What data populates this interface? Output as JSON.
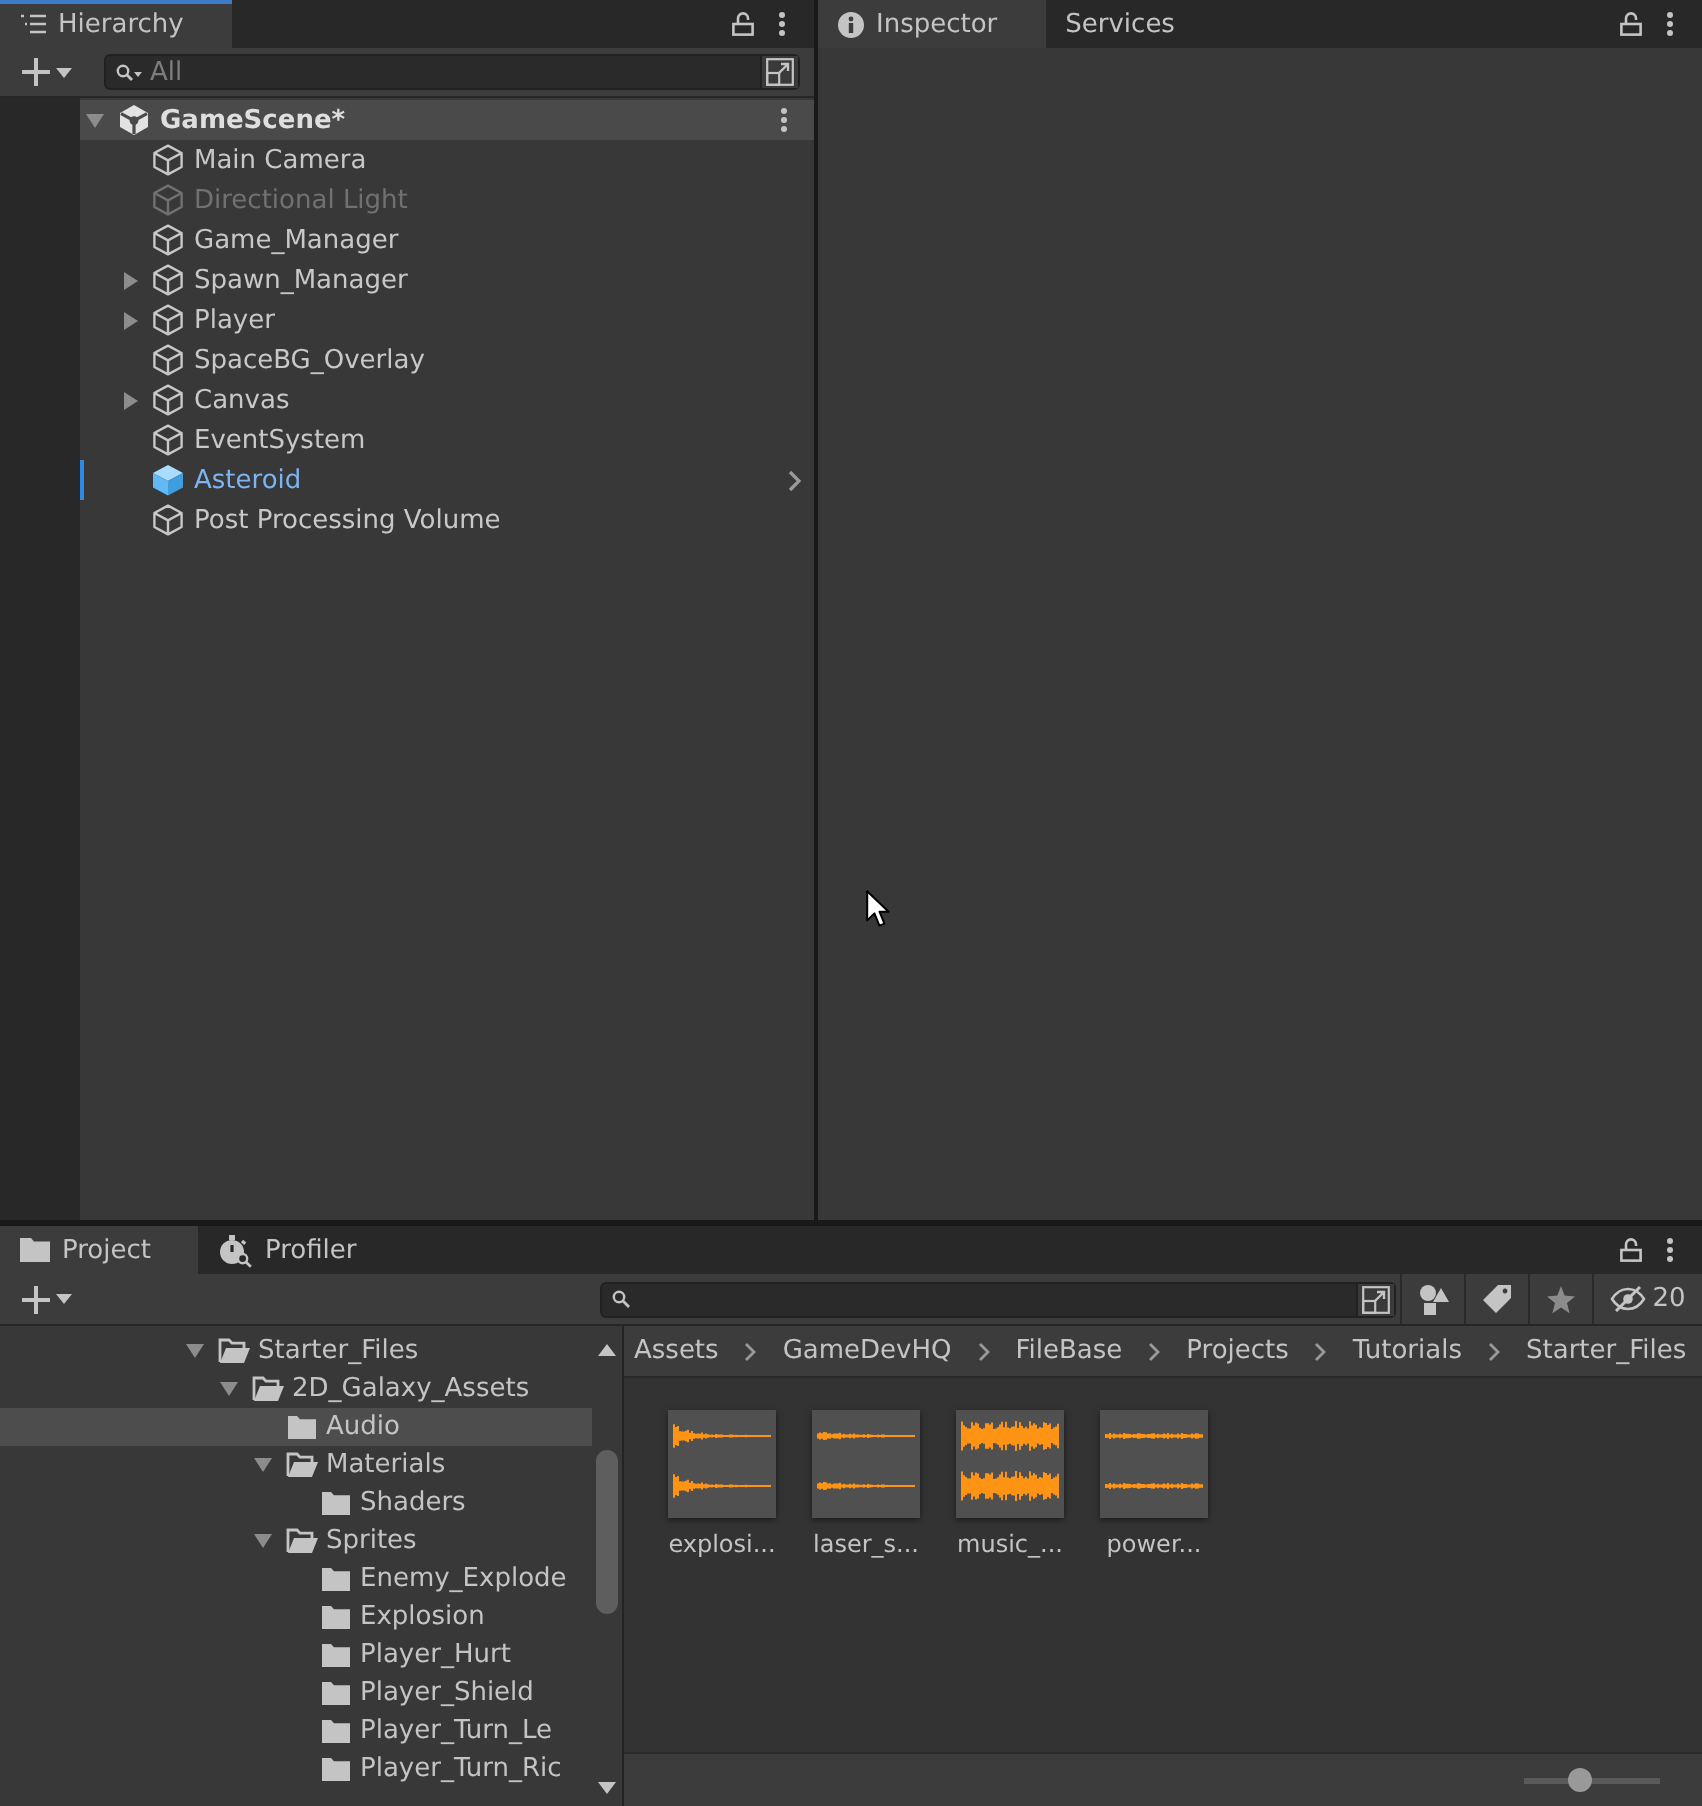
{
  "hierarchy": {
    "focused": true,
    "tabs": [
      {
        "label": "Hierarchy",
        "selected": true
      }
    ],
    "search": {
      "placeholder": "All"
    },
    "scene": {
      "name": "GameScene*",
      "expanded": true,
      "objects": [
        {
          "name": "Main Camera",
          "kind": "object",
          "active": true,
          "expandable": false,
          "overridden": false,
          "selected": false
        },
        {
          "name": "Directional Light",
          "kind": "object",
          "active": false,
          "expandable": false,
          "overridden": false,
          "selected": false
        },
        {
          "name": "Game_Manager",
          "kind": "object",
          "active": true,
          "expandable": false,
          "overridden": false,
          "selected": false
        },
        {
          "name": "Spawn_Manager",
          "kind": "object",
          "active": true,
          "expandable": true,
          "overridden": false,
          "selected": false
        },
        {
          "name": "Player",
          "kind": "object",
          "active": true,
          "expandable": true,
          "overridden": false,
          "selected": false
        },
        {
          "name": "SpaceBG_Overlay",
          "kind": "object",
          "active": true,
          "expandable": false,
          "overridden": false,
          "selected": false
        },
        {
          "name": "Canvas",
          "kind": "object",
          "active": true,
          "expandable": true,
          "overridden": false,
          "selected": false
        },
        {
          "name": "EventSystem",
          "kind": "object",
          "active": true,
          "expandable": false,
          "overridden": false,
          "selected": false
        },
        {
          "name": "Asteroid",
          "kind": "prefab",
          "active": true,
          "expandable": false,
          "overridden": true,
          "selected": false
        },
        {
          "name": "Post Processing Volume",
          "kind": "object",
          "active": true,
          "expandable": false,
          "overridden": false,
          "selected": false
        }
      ]
    }
  },
  "inspector": {
    "focused": false,
    "tabs": [
      {
        "label": "Inspector",
        "selected": true
      },
      {
        "label": "Services",
        "selected": false
      }
    ]
  },
  "project": {
    "focused": false,
    "tabs": [
      {
        "label": "Project",
        "selected": true
      },
      {
        "label": "Profiler",
        "selected": false
      }
    ],
    "hidden_packages": "20",
    "folders": [
      {
        "name": "Starter_Files",
        "expanded": true,
        "selected": false,
        "children": [
          {
            "name": "2D_Galaxy_Assets",
            "expanded": true,
            "selected": false,
            "children": [
              {
                "name": "Audio",
                "selected": true
              },
              {
                "name": "Materials",
                "expanded": true,
                "selected": false,
                "children": [
                  {
                    "name": "Shaders",
                    "selected": false
                  }
                ]
              },
              {
                "name": "Sprites",
                "expanded": true,
                "selected": false,
                "children": [
                  {
                    "name": "Enemy_Explode",
                    "selected": false
                  },
                  {
                    "name": "Explosion",
                    "selected": false
                  },
                  {
                    "name": "Player_Hurt",
                    "selected": false
                  },
                  {
                    "name": "Player_Shield",
                    "selected": false
                  },
                  {
                    "name": "Player_Turn_Le",
                    "selected": false
                  },
                  {
                    "name": "Player_Turn_Ric",
                    "selected": false
                  }
                ]
              }
            ]
          }
        ]
      }
    ],
    "breadcrumb": [
      "Assets",
      "GameDevHQ",
      "FileBase",
      "Projects",
      "Tutorials",
      "Starter_Files"
    ],
    "assets": [
      {
        "label": "explosi...",
        "selected": false
      },
      {
        "label": "laser_s...",
        "selected": false
      },
      {
        "label": "music_...",
        "selected": false
      },
      {
        "label": "power...",
        "selected": false
      }
    ],
    "icon_size": {
      "level": 0.4
    }
  }
}
